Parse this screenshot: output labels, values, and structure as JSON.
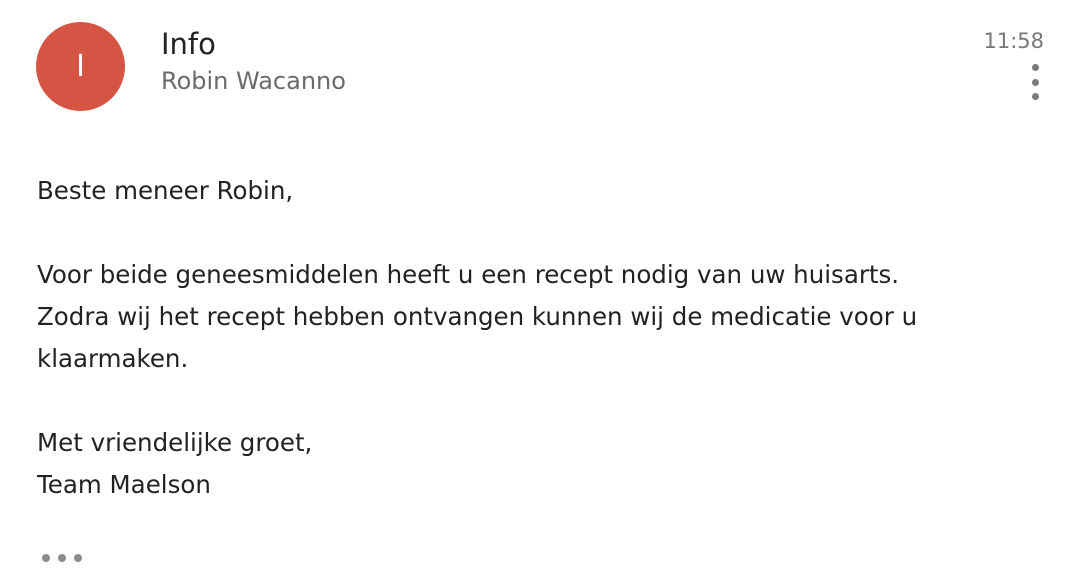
{
  "email": {
    "avatar_letter": "I",
    "avatar_color": "#d65443",
    "sender": "Info",
    "recipient": "Robin Wacanno",
    "time": "11:58",
    "more_icon": "more-vert-icon",
    "body": {
      "greeting": "Beste meneer Robin,",
      "line1": "Voor beide geneesmiddelen heeft u een recept nodig van uw huisarts.",
      "line2": "Zodra wij het recept hebben ontvangen kunnen wij de medicatie voor u",
      "line3": "klaarmaken.",
      "closing": "Met vriendelijke groet,",
      "signature": "Team Maelson"
    },
    "trimmed_content_icon": "more-horiz-icon"
  }
}
